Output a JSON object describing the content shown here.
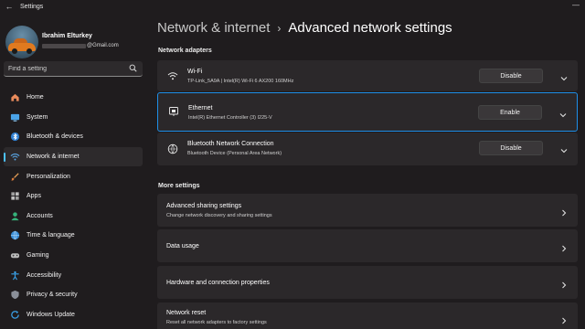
{
  "titlebar": {
    "title": "Settings"
  },
  "profile": {
    "name": "Ibrahim Elturkey",
    "email_suffix": "@Gmail.com"
  },
  "search": {
    "placeholder": "Find a setting"
  },
  "nav": {
    "items": [
      {
        "label": "Home",
        "icon": "home-icon"
      },
      {
        "label": "System",
        "icon": "monitor-icon"
      },
      {
        "label": "Bluetooth & devices",
        "icon": "bluetooth-icon"
      },
      {
        "label": "Network & internet",
        "icon": "wifi-icon",
        "active": true
      },
      {
        "label": "Personalization",
        "icon": "brush-icon"
      },
      {
        "label": "Apps",
        "icon": "apps-icon"
      },
      {
        "label": "Accounts",
        "icon": "person-icon"
      },
      {
        "label": "Time & language",
        "icon": "globe-clock-icon"
      },
      {
        "label": "Gaming",
        "icon": "gamepad-icon"
      },
      {
        "label": "Accessibility",
        "icon": "accessibility-icon"
      },
      {
        "label": "Privacy & security",
        "icon": "shield-icon"
      },
      {
        "label": "Windows Update",
        "icon": "update-icon"
      }
    ]
  },
  "breadcrumb": {
    "parent": "Network & internet",
    "separator": "›",
    "current": "Advanced network settings"
  },
  "network_adapters": {
    "title": "Network adapters",
    "items": [
      {
        "name": "Wi-Fi",
        "description": "TP-Link_5A9A | Intel(R) Wi-Fi 6 AX200 160MHz",
        "button": "Disable",
        "icon": "wifi-icon"
      },
      {
        "name": "Ethernet",
        "description": "Intel(R) Ethernet Controller (3) I225-V",
        "button": "Enable",
        "icon": "ethernet-icon",
        "selected": true
      },
      {
        "name": "Bluetooth Network Connection",
        "description": "Bluetooth Device (Personal Area Network)",
        "button": "Disable",
        "icon": "bluetooth-network-icon"
      }
    ]
  },
  "more_settings": {
    "title": "More settings",
    "items": [
      {
        "name": "Advanced sharing settings",
        "description": "Change network discovery and sharing settings"
      },
      {
        "name": "Data usage",
        "description": ""
      },
      {
        "name": "Hardware and connection properties",
        "description": ""
      },
      {
        "name": "Network reset",
        "description": "Reset all network adapters to factory settings"
      }
    ]
  },
  "colors": {
    "accent": "#4cc2ff",
    "selection_border": "#1e8fe8",
    "background": "#1f1c1e",
    "card": "#2b282a"
  }
}
